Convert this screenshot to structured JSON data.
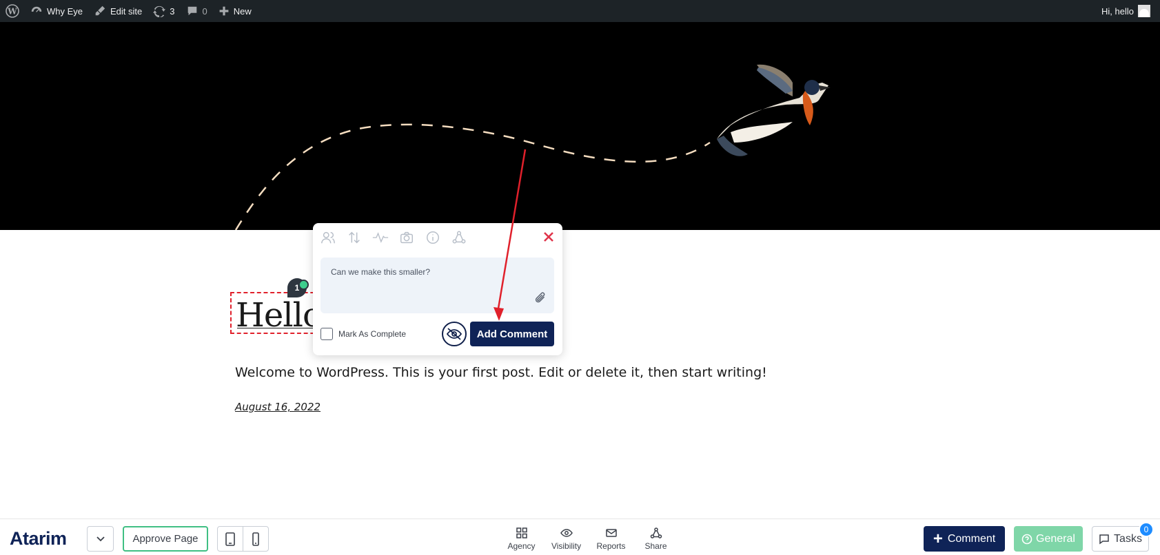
{
  "admin_bar": {
    "site_name": "Why Eye",
    "edit_site": "Edit site",
    "updates_count": "3",
    "comments_count": "0",
    "new_label": "New",
    "greeting": "Hi, hello"
  },
  "post": {
    "title": "Hello",
    "body": "Welcome to WordPress. This is your first post. Edit or delete it, then start writing!",
    "date": "August 16, 2022"
  },
  "pin": {
    "number": "1"
  },
  "comment_popup": {
    "tools": [
      "people-icon",
      "sort-icon",
      "activity-icon",
      "camera-icon",
      "info-icon",
      "share-icon"
    ],
    "comment_text": "Can we make this smaller?",
    "mark_complete_label": "Mark As Complete",
    "add_comment_label": "Add Comment"
  },
  "bottom_bar": {
    "logo": "Atarim",
    "approve_label": "Approve Page",
    "nav": [
      {
        "label": "Agency",
        "icon": "grid-icon"
      },
      {
        "label": "Visibility",
        "icon": "eye-icon"
      },
      {
        "label": "Reports",
        "icon": "mail-icon"
      },
      {
        "label": "Share",
        "icon": "share-icon"
      }
    ],
    "comment_label": "Comment",
    "general_label": "General",
    "tasks_label": "Tasks",
    "tasks_count": "0"
  },
  "colors": {
    "navy": "#0f2357",
    "green": "#3fbf83",
    "admin_bar": "#1d2327",
    "annotation_red": "#e0202b"
  }
}
